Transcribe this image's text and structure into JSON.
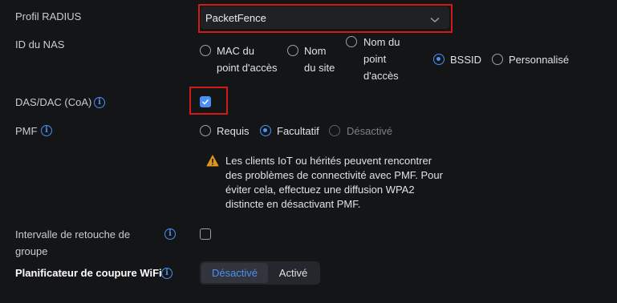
{
  "radius_profile": {
    "label": "Profil RADIUS",
    "value": "PacketFence"
  },
  "nas_id": {
    "label": "ID du NAS",
    "options": [
      {
        "lines": [
          "MAC du",
          "point d'accès"
        ],
        "checked": false
      },
      {
        "lines": [
          "Nom",
          "du site"
        ],
        "checked": false
      },
      {
        "lines": [
          "Nom du",
          "point",
          "d'accès"
        ],
        "checked": false
      },
      {
        "lines": [
          "BSSID"
        ],
        "checked": true
      },
      {
        "lines": [
          "Personnalisé"
        ],
        "checked": false
      }
    ]
  },
  "das_dac": {
    "label": "DAS/DAC (CoA)",
    "checked": true
  },
  "pmf": {
    "label": "PMF",
    "options": [
      {
        "label": "Requis",
        "checked": false,
        "disabled": false
      },
      {
        "label": "Facultatif",
        "checked": true,
        "disabled": false
      },
      {
        "label": "Désactivé",
        "checked": false,
        "disabled": true
      }
    ],
    "warning": "Les clients IoT ou hérités peuvent rencontrer des problèmes de connectivité avec PMF. Pour éviter cela, effectuez une diffusion WPA2 distincte en désactivant PMF."
  },
  "group_rekey": {
    "label_line1": "Intervalle de retouche de",
    "label_line2": "groupe",
    "checked": false
  },
  "wifi_scheduler": {
    "label": "Planificateur de coupure WiFi",
    "options": [
      "Désactivé",
      "Activé"
    ],
    "selected": "Désactivé"
  },
  "colors": {
    "accent": "#4a8ff5",
    "highlight": "#d31a1a",
    "warning": "#e0961e"
  }
}
